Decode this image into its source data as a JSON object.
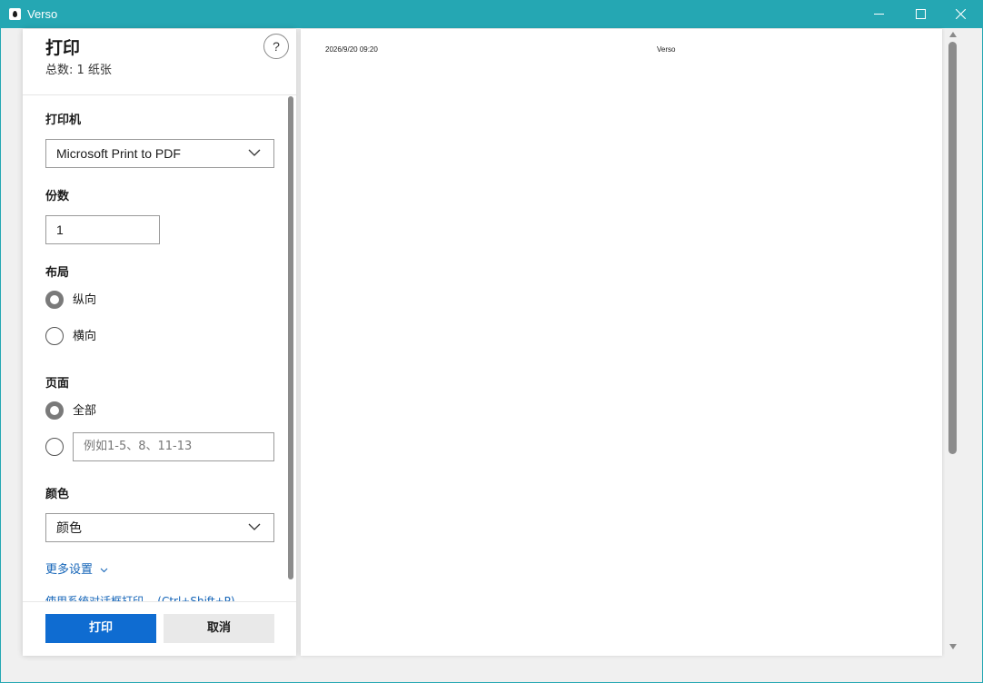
{
  "window": {
    "title": "Verso"
  },
  "dialog": {
    "title": "打印",
    "summary": "总数: 1 纸张",
    "help_label": "?"
  },
  "printer": {
    "label": "打印机",
    "selected": "Microsoft Print to PDF"
  },
  "copies": {
    "label": "份数",
    "value": "1"
  },
  "layout": {
    "label": "布局",
    "options": [
      {
        "label": "纵向",
        "checked": true
      },
      {
        "label": "横向",
        "checked": false
      }
    ]
  },
  "pages": {
    "label": "页面",
    "all_label": "全部",
    "all_checked": true,
    "range_placeholder": "例如1-5、8、11-13"
  },
  "color": {
    "label": "颜色",
    "selected": "颜色"
  },
  "more_settings": "更多设置",
  "system_dialog_link": "使用系统对话框打印... (Ctrl+Shift+P)",
  "buttons": {
    "print": "打印",
    "cancel": "取消"
  },
  "preview": {
    "header_date": "2026/9/20 09:20",
    "header_title": "Verso"
  },
  "colors": {
    "titlebar": "#25a7b3",
    "primary_button": "#0f6cd1",
    "link": "#1565b8"
  }
}
